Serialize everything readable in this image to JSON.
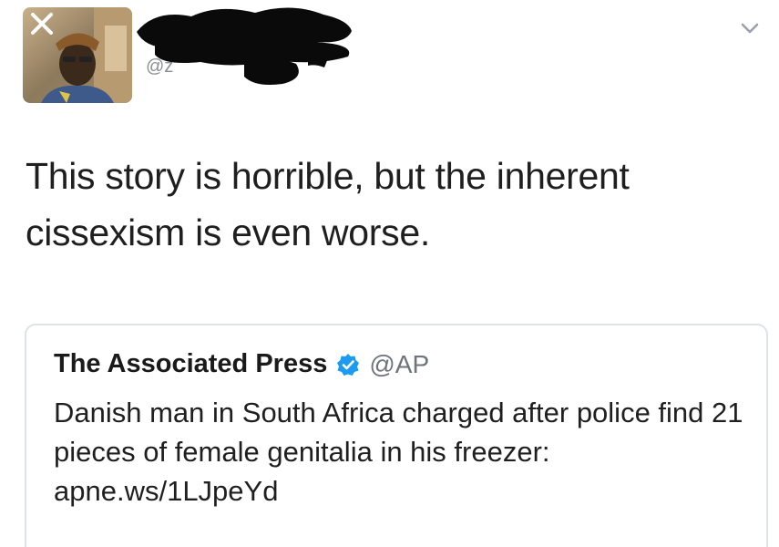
{
  "tweet": {
    "handle_partial": "@z",
    "text": "This story is horrible, but the inherent cissexism is even worse."
  },
  "quoted_tweet": {
    "author_name": "The Associated Press",
    "verified": true,
    "handle": "@AP",
    "text": "Danish man in South Africa charged after police find 21 pieces of female genitalia in his freezer: apne.ws/1LJpeYd"
  },
  "icons": {
    "close": "close-icon",
    "menu": "chevron-down-icon",
    "verified": "verified-badge-icon"
  },
  "colors": {
    "verified_blue": "#1d9bf0",
    "handle_gray": "#6d747b",
    "border": "#dde3e8",
    "redaction": "#0a0a0a"
  }
}
